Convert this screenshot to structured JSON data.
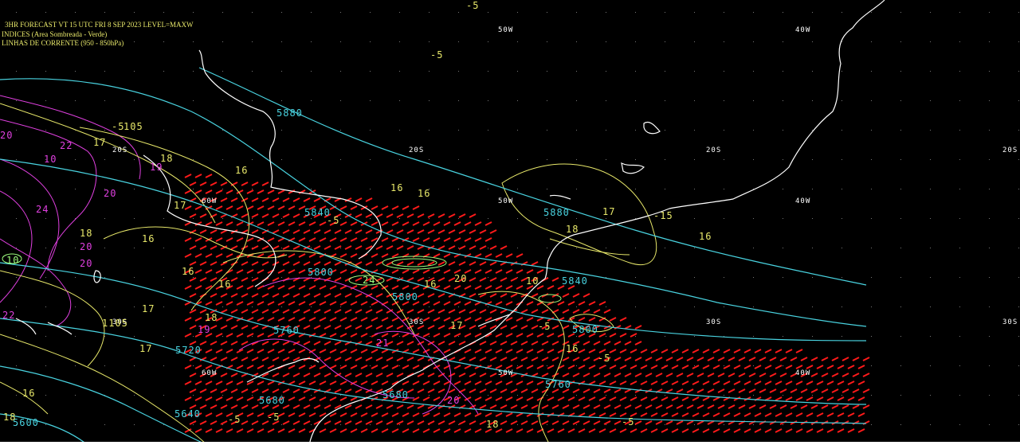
{
  "header": {
    "line1": "3HR FORECAST   VT 15 UTC FRI 8 SEP 2023   LEVEL=MAXW",
    "line2": "INDICES (Area Sombreada - Verde)",
    "line3": "LINHAS DE CORRENTE (950 - 850hPa)"
  },
  "grid_labels": {
    "lon_50w": "50W",
    "lon_40w": "40W",
    "lat_20s": "20S",
    "lat_30s": "30S",
    "lon_60w": "60W"
  },
  "contours": {
    "c5880": "5880",
    "c5840": "5840",
    "c5800": "5800",
    "c5760": "5760",
    "c5720": "5720",
    "c5680": "5680",
    "c5640": "5640",
    "c5600": "5600"
  },
  "indices": {
    "i16": "16",
    "i17": "17",
    "i18": "18",
    "i19": "19",
    "i20": "20",
    "i21": "21",
    "i22": "22",
    "i24": "24",
    "neg5": "-5",
    "neg15": "-15",
    "i10": "10",
    "i105": "105",
    "i1105": "1105"
  },
  "colors": {
    "background": "#000000",
    "coastline": "#ffffff",
    "geopotential": "#49d3e0",
    "k_index": "#e8e86a",
    "magenta": "#e040e0",
    "wind_barbs": "#ff1a1a",
    "green_shading": "#9fff7f"
  }
}
